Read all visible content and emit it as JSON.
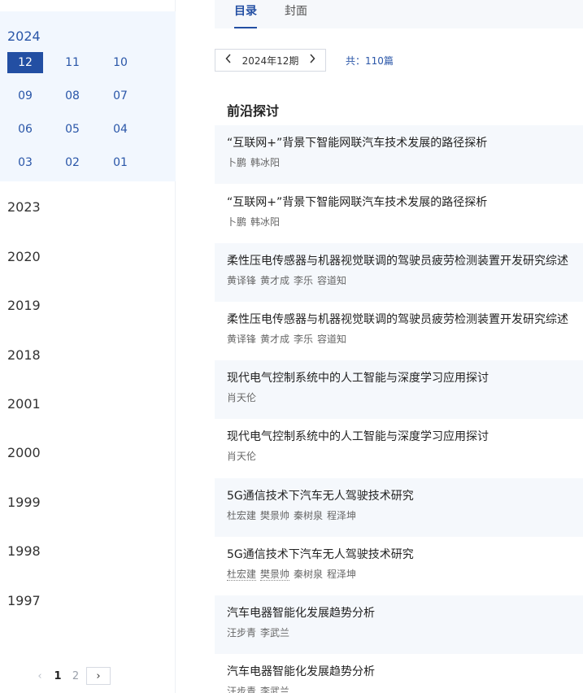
{
  "sidebar": {
    "expanded_year": "2024",
    "months": [
      "12",
      "11",
      "10",
      "09",
      "08",
      "07",
      "06",
      "05",
      "04",
      "03",
      "02",
      "01"
    ],
    "active_month": "12",
    "years": [
      "2023",
      "2020",
      "2019",
      "2018",
      "2001",
      "2000",
      "1999",
      "1998",
      "1997"
    ],
    "pager": {
      "prev": "‹",
      "pages": [
        "1",
        "2"
      ],
      "current": "1",
      "next": "›"
    }
  },
  "tabs": [
    {
      "label": "目录",
      "active": true
    },
    {
      "label": "封面",
      "active": false
    }
  ],
  "issue": {
    "label": "2024年12期",
    "prev_icon": "chevron-left",
    "next_icon": "chevron-right"
  },
  "total_text": "共：110篇",
  "section_title": "前沿探讨",
  "articles": [
    {
      "title": "“互联网+”背景下智能网联汽车技术发展的路径探析",
      "authors": [
        "卜鹏",
        "韩冰阳"
      ]
    },
    {
      "title": "“互联网+”背景下智能网联汽车技术发展的路径探析",
      "authors": [
        "卜鹏",
        "韩冰阳"
      ]
    },
    {
      "title": "柔性压电传感器与机器视觉联调的驾驶员疲劳检测装置开发研究综述",
      "authors": [
        "黄译锋",
        "黄才成",
        "李乐",
        "容道知"
      ]
    },
    {
      "title": "柔性压电传感器与机器视觉联调的驾驶员疲劳检测装置开发研究综述",
      "authors": [
        "黄译锋",
        "黄才成",
        "李乐",
        "容道知"
      ]
    },
    {
      "title": "现代电气控制系统中的人工智能与深度学习应用探讨",
      "authors": [
        "肖天伦"
      ]
    },
    {
      "title": "现代电气控制系统中的人工智能与深度学习应用探讨",
      "authors": [
        "肖天伦"
      ]
    },
    {
      "title": "5G通信技术下汽车无人驾驶技术研究",
      "authors": [
        "杜宏建",
        "樊景帅",
        "秦树泉",
        "程泽坤"
      ]
    },
    {
      "title": "5G通信技术下汽车无人驾驶技术研究",
      "authors": [
        "杜宏建",
        "樊景帅",
        "秦树泉",
        "程泽坤"
      ]
    },
    {
      "title": "汽车电器智能化发展趋势分析",
      "authors": [
        "汪步青",
        "李武兰"
      ]
    },
    {
      "title": "汽车电器智能化发展趋势分析",
      "authors": [
        "汪步青",
        "李武兰"
      ]
    }
  ],
  "colors": {
    "accent": "#234fa3",
    "link": "#2a56a8",
    "sidebar_highlight": "#f2f7fe",
    "row_shade": "#f5f8fc"
  }
}
